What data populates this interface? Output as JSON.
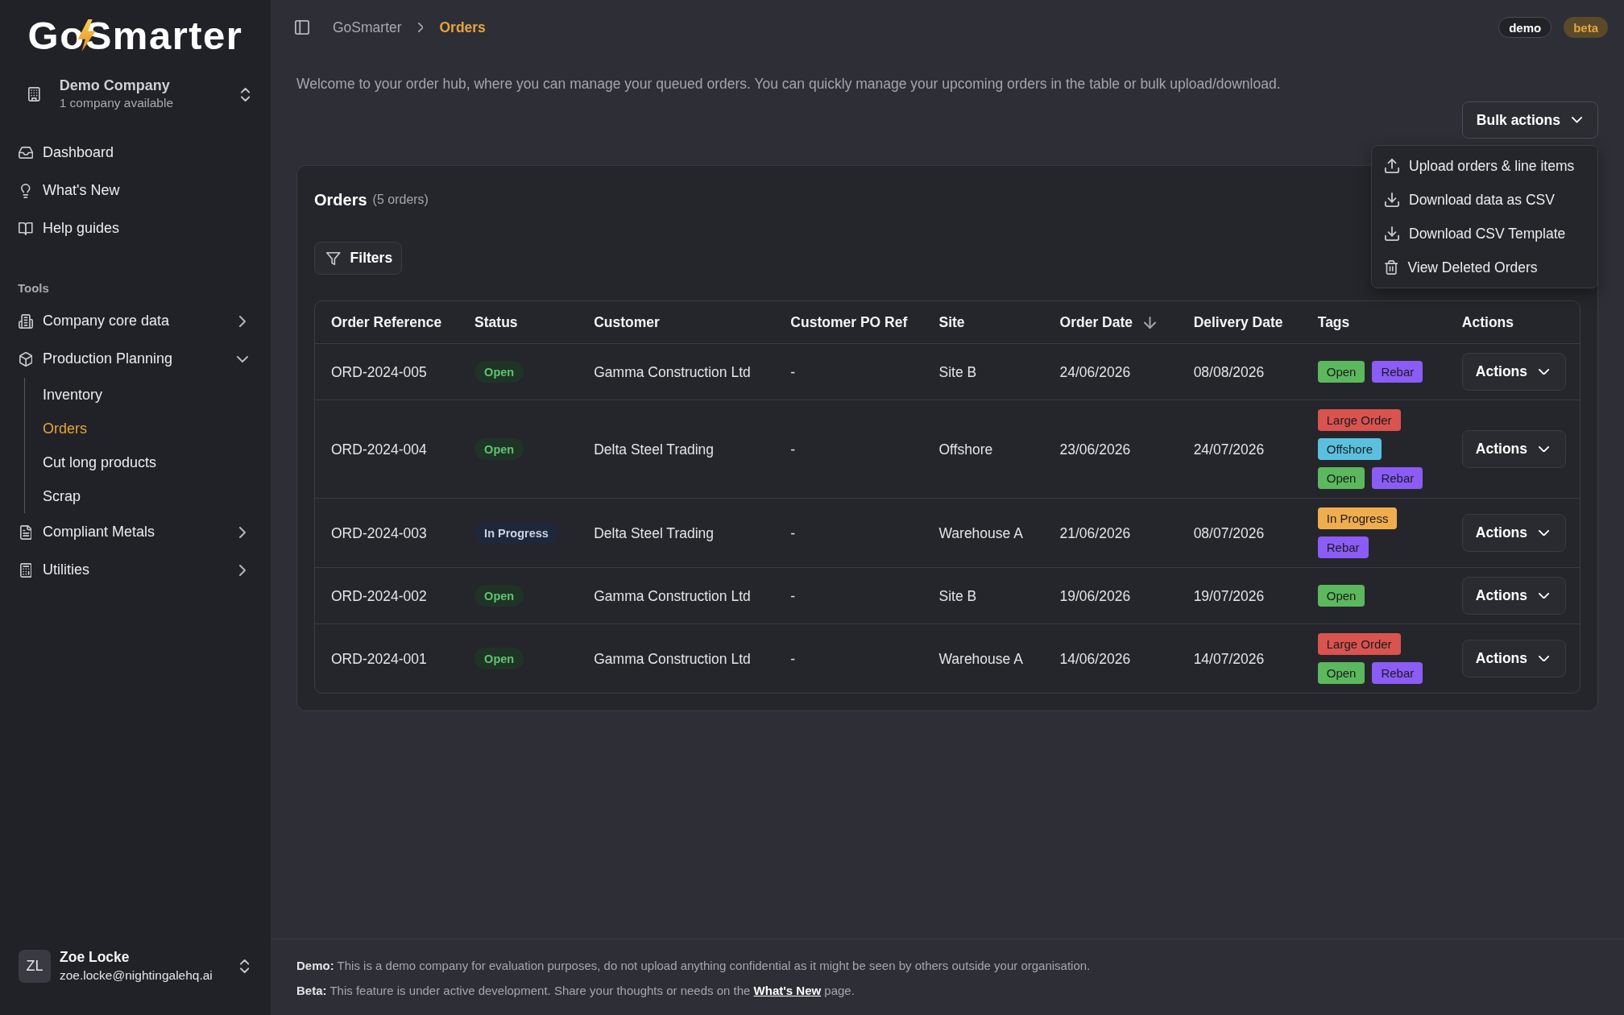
{
  "sidebar": {
    "logo": "GoSmarter",
    "company": {
      "name": "Demo Company",
      "subtitle": "1 company available"
    },
    "nav": [
      {
        "label": "Dashboard",
        "selected": false
      },
      {
        "label": "What's New",
        "selected": false
      },
      {
        "label": "Help guides",
        "selected": false
      }
    ],
    "section_title": "Tools",
    "tools": [
      {
        "label": "Company core data",
        "expanded": false
      },
      {
        "label": "Production Planning",
        "expanded": true,
        "children": [
          {
            "label": "Inventory",
            "selected": false
          },
          {
            "label": "Orders",
            "selected": true
          },
          {
            "label": "Cut long products",
            "selected": false
          },
          {
            "label": "Scrap",
            "selected": false
          }
        ]
      },
      {
        "label": "Compliant Metals",
        "expanded": false
      },
      {
        "label": "Utilities",
        "expanded": false
      }
    ],
    "user": {
      "initials": "ZL",
      "name": "Zoe Locke",
      "email": "zoe.locke@nightingalehq.ai"
    }
  },
  "header": {
    "breadcrumb": [
      "GoSmarter",
      "Orders"
    ],
    "badges": [
      {
        "label": "demo",
        "kind": "outline"
      },
      {
        "label": "beta",
        "kind": "accent"
      }
    ]
  },
  "content": {
    "intro": "Welcome to your order hub, where you can manage your queued orders. You can quickly manage your upcoming orders in the table or bulk upload/download.",
    "bulk_actions": {
      "label": "Bulk actions",
      "expanded": true,
      "menu": [
        "Upload orders & line items",
        "Download data as CSV",
        "Download CSV Template",
        "View Deleted Orders"
      ]
    },
    "orders_card": {
      "title": "Orders",
      "count": "(5 orders)",
      "filters_button": "Filters",
      "table": {
        "columns": [
          {
            "label": "Order Reference",
            "sorted": false
          },
          {
            "label": "Status",
            "sorted": false
          },
          {
            "label": "Customer",
            "sorted": false
          },
          {
            "label": "Customer PO Ref",
            "sorted": false
          },
          {
            "label": "Site",
            "sorted": false
          },
          {
            "label": "Order Date",
            "sorted": true
          },
          {
            "label": "Delivery Date",
            "sorted": false
          },
          {
            "label": "Tags",
            "sorted": false
          },
          {
            "label": "Actions",
            "sorted": false
          }
        ],
        "rows": [
          {
            "reference": "ORD-2024-005",
            "status": {
              "label": "Open",
              "kind": "open"
            },
            "customer": "Gamma Construction Ltd",
            "po_ref": "-",
            "site": "Site B",
            "order_date": "24/06/2026",
            "delivery_date": "08/08/2026",
            "tags": [
              {
                "label": "Open",
                "color": "#5cb85c"
              },
              {
                "label": "Rebar",
                "color": "#8b5cf6"
              }
            ],
            "action": "Actions"
          },
          {
            "reference": "ORD-2024-004",
            "status": {
              "label": "Open",
              "kind": "open"
            },
            "customer": "Delta Steel Trading",
            "po_ref": "-",
            "site": "Offshore",
            "order_date": "23/06/2026",
            "delivery_date": "24/07/2026",
            "tags": [
              {
                "label": "Large Order",
                "color": "#d9534f"
              },
              {
                "label": "Offshore",
                "color": "#5bc0de"
              },
              {
                "label": "Open",
                "color": "#5cb85c"
              },
              {
                "label": "Rebar",
                "color": "#8b5cf6"
              }
            ],
            "action": "Actions"
          },
          {
            "reference": "ORD-2024-003",
            "status": {
              "label": "In Progress",
              "kind": "in_progress"
            },
            "customer": "Delta Steel Trading",
            "po_ref": "-",
            "site": "Warehouse A",
            "order_date": "21/06/2026",
            "delivery_date": "08/07/2026",
            "tags": [
              {
                "label": "In Progress",
                "color": "#f0ad4e"
              },
              {
                "label": "Rebar",
                "color": "#8b5cf6"
              }
            ],
            "action": "Actions"
          },
          {
            "reference": "ORD-2024-002",
            "status": {
              "label": "Open",
              "kind": "open"
            },
            "customer": "Gamma Construction Ltd",
            "po_ref": "-",
            "site": "Site B",
            "order_date": "19/06/2026",
            "delivery_date": "19/07/2026",
            "tags": [
              {
                "label": "Open",
                "color": "#5cb85c"
              }
            ],
            "action": "Actions"
          },
          {
            "reference": "ORD-2024-001",
            "status": {
              "label": "Open",
              "kind": "open"
            },
            "customer": "Gamma Construction Ltd",
            "po_ref": "-",
            "site": "Warehouse A",
            "order_date": "14/06/2026",
            "delivery_date": "14/07/2026",
            "tags": [
              {
                "label": "Large Order",
                "color": "#d9534f"
              },
              {
                "label": "Open",
                "color": "#5cb85c"
              },
              {
                "label": "Rebar",
                "color": "#8b5cf6"
              }
            ],
            "action": "Actions"
          }
        ]
      }
    }
  },
  "footer": {
    "notes": [
      {
        "lead": "Demo:",
        "text": "This is a demo company for evaluation purposes, do not upload anything confidential as it might be seen by others outside your organisation."
      },
      {
        "lead": "Beta:",
        "text": "This feature is under active development. Share your thoughts or needs on the",
        "link": "What's New",
        "after": "page."
      }
    ]
  }
}
